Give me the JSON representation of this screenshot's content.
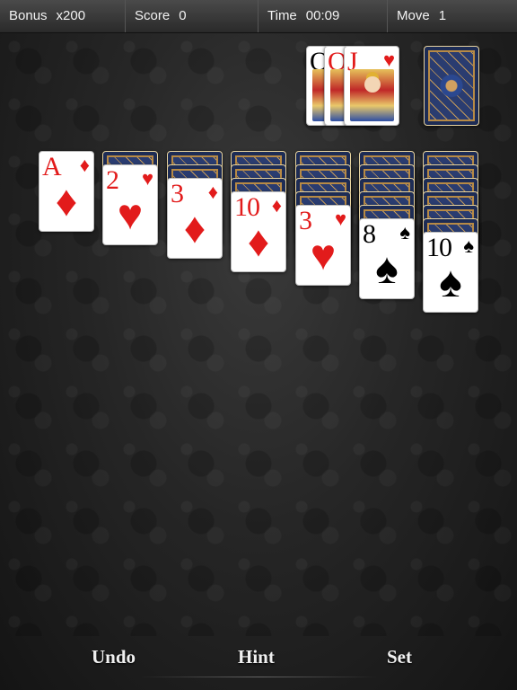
{
  "header": {
    "bonus_label": "Bonus",
    "bonus_value": "x200",
    "score_label": "Score",
    "score_value": "0",
    "time_label": "Time",
    "time_value": "00:09",
    "move_label": "Move",
    "move_value": "1"
  },
  "waste": [
    {
      "rank": "Q",
      "suit": "heart",
      "color": "red"
    },
    {
      "rank": "Q",
      "suit": "heart",
      "color": "red"
    },
    {
      "rank": "J",
      "suit": "heart",
      "color": "red",
      "glyph": "♥"
    }
  ],
  "tableau": [
    {
      "face_down": 0,
      "top": {
        "rank": "A",
        "glyph": "♦",
        "color": "red"
      }
    },
    {
      "face_down": 1,
      "top": {
        "rank": "2",
        "glyph": "♥",
        "color": "red"
      }
    },
    {
      "face_down": 2,
      "top": {
        "rank": "3",
        "glyph": "♦",
        "color": "red"
      }
    },
    {
      "face_down": 3,
      "top": {
        "rank": "10",
        "glyph": "♦",
        "color": "red"
      }
    },
    {
      "face_down": 4,
      "top": {
        "rank": "3",
        "glyph": "♥",
        "color": "red"
      }
    },
    {
      "face_down": 5,
      "top": {
        "rank": "8",
        "glyph": "♠",
        "color": "black"
      }
    },
    {
      "face_down": 6,
      "top": {
        "rank": "10",
        "glyph": "♠",
        "color": "black"
      }
    }
  ],
  "toolbar": {
    "undo_label": "Undo",
    "hint_label": "Hint",
    "set_label": "Set"
  },
  "colors": {
    "red_suit": "#e21b1b",
    "card_back": "#1d2c55"
  }
}
